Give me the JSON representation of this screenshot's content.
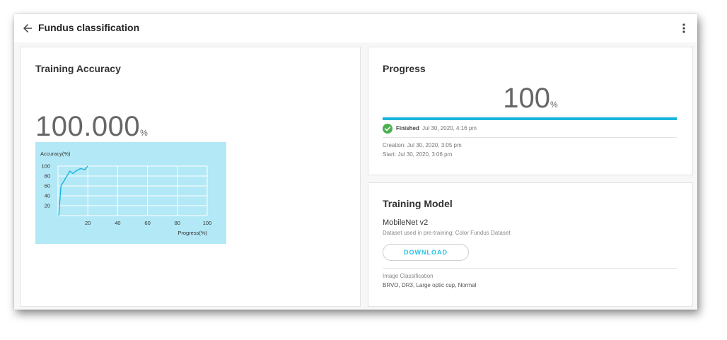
{
  "header": {
    "title": "Fundus classification",
    "back_icon": "arrow-left-icon",
    "menu_icon": "more-vert-icon"
  },
  "accuracy": {
    "title": "Training Accuracy",
    "value": "100.000",
    "unit": "%"
  },
  "chart_data": {
    "type": "line",
    "ylabel": "Accuracy(%)",
    "xlabel": "Progress(%)",
    "x_ticks": [
      "20",
      "40",
      "60",
      "80",
      "100"
    ],
    "y_ticks": [
      "20",
      "40",
      "60",
      "80",
      "100"
    ],
    "xlim": [
      0,
      100
    ],
    "ylim": [
      0,
      100
    ],
    "grid": true,
    "background": "#b3e8f6",
    "line_color": "#19b4dc",
    "series": [
      {
        "x": [
          0.5,
          2,
          5,
          8,
          10,
          12,
          15,
          18,
          20
        ],
        "y": [
          0,
          60,
          75,
          90,
          85,
          90,
          95,
          93,
          100
        ]
      }
    ]
  },
  "progress": {
    "title": "Progress",
    "value": "100",
    "unit": "%",
    "fraction": 1.0,
    "bar_color": "#1bb6dc",
    "status_icon": "check-circle-icon",
    "status_color": "#4caf50",
    "status_label": "Finished",
    "status_time": "Jul 30, 2020, 4:16 pm",
    "creation": "Creation: Jul 30, 2020, 3:05 pm",
    "start": "Start: Jul 30, 2020, 3:06 pm"
  },
  "model": {
    "title": "Training Model",
    "name": "MobileNet v2",
    "dataset": "Dataset used in pre-training: Color Fundus Dataset",
    "download_label": "DOWNLOAD",
    "task_type": "Image Classification",
    "classes": "BRVO, DR3, Large optic cup, Normal"
  }
}
